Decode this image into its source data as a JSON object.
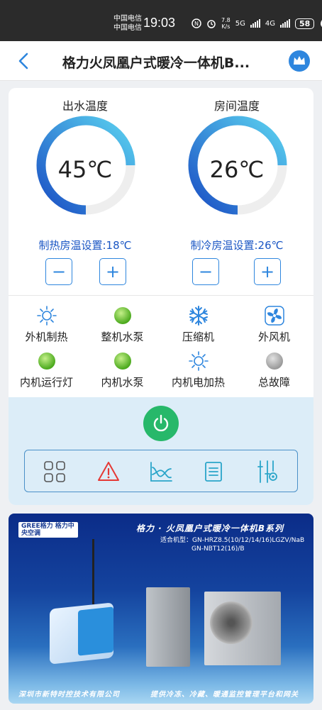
{
  "status_bar": {
    "carrier_line1": "中国电信",
    "carrier_line2": "中国电信",
    "time": "19:03",
    "speed_value": "7.8",
    "speed_unit": "K/s",
    "network1": "5G",
    "network2": "4G",
    "battery": "58"
  },
  "header": {
    "title": "格力火凤凰户式暖冷一体机B...",
    "back_icon": "chevron-left-icon",
    "crown_icon": "crown-icon"
  },
  "gauges": {
    "outlet": {
      "title": "出水温度",
      "value": "45℃",
      "setting": "制热房温设置:18℃",
      "fill_fraction": 0.75
    },
    "room": {
      "title": "房间温度",
      "value": "26℃",
      "setting": "制冷房温设置:26℃",
      "fill_fraction": 0.75
    }
  },
  "stepper": {
    "minus": "−",
    "plus": "+"
  },
  "status_items": [
    {
      "label": "外机制热",
      "icon": "sun-icon"
    },
    {
      "label": "整机水泵",
      "icon": "green-dot-icon"
    },
    {
      "label": "压缩机",
      "icon": "snowflake-icon"
    },
    {
      "label": "外风机",
      "icon": "fan-icon"
    },
    {
      "label": "内机运行灯",
      "icon": "green-dot-icon"
    },
    {
      "label": "内机水泵",
      "icon": "green-dot-icon"
    },
    {
      "label": "内机电加热",
      "icon": "sun-icon"
    },
    {
      "label": "总故障",
      "icon": "gray-dot-icon"
    }
  ],
  "toolbar": {
    "items": [
      "grid-icon",
      "warning-icon",
      "chart-icon",
      "list-icon",
      "sliders-icon"
    ]
  },
  "banner": {
    "logo": "GREE格力 格力中央空调",
    "title": "格力 · 火凤凰户式暖冷一体机B系列",
    "models_line1": "适合机型：GN-HRZ8.5(10/12/14/16)LGZV/NaB",
    "models_line2": "GN-NBT12(16)/B",
    "company": "深圳市新特时控技术有限公司",
    "slogan": "提供冷冻、冷藏、暖通监控管理平台和网关"
  },
  "colors": {
    "accent": "#2e86de",
    "gauge_start": "#1a4fc4",
    "gauge_end": "#5bd2f0",
    "power": "#27b86a",
    "setting_text": "#1a56c4"
  }
}
